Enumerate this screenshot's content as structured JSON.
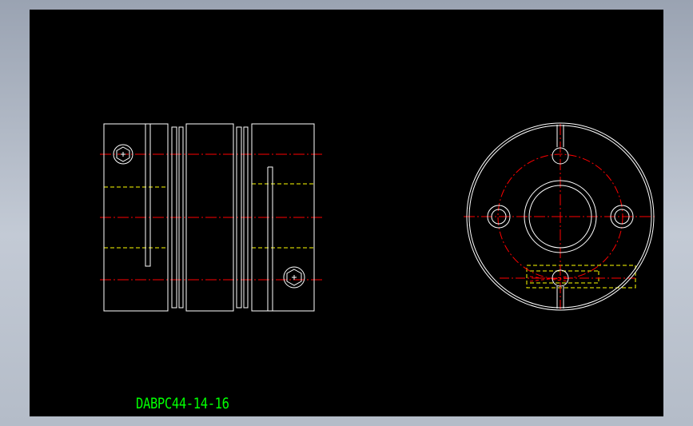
{
  "drawing": {
    "part_number": "DABPC44-14-16"
  },
  "colors": {
    "background": "#000000",
    "outline": "#ffffff",
    "centerline": "#ff0000",
    "hidden": "#ffff00",
    "label": "#00ff00"
  }
}
